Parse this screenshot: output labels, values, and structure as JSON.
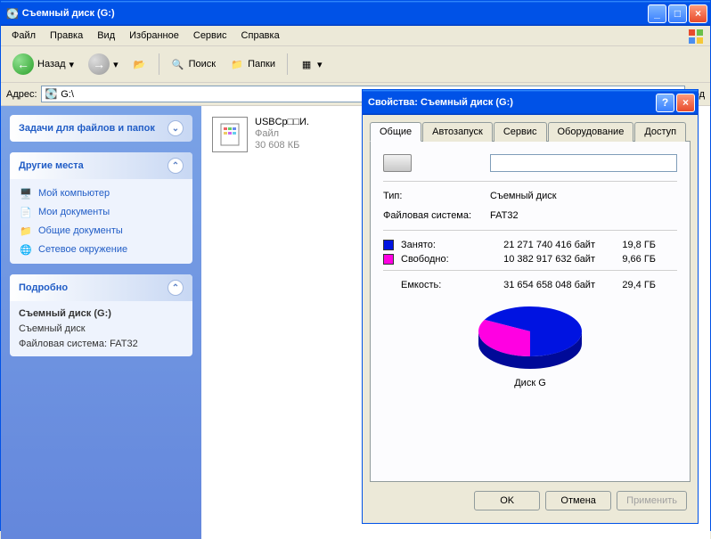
{
  "main": {
    "title": "Съемный диск (G:)",
    "menu": [
      "Файл",
      "Правка",
      "Вид",
      "Избранное",
      "Сервис",
      "Справка"
    ],
    "toolbar": {
      "back": "Назад",
      "search": "Поиск",
      "folders": "Папки"
    },
    "address_label": "Адрес:",
    "address_value": "G:\\",
    "go": "ход",
    "sidebar": {
      "tasks_title": "Задачи для файлов и папок",
      "places_title": "Другие места",
      "places": [
        "Мой компьютер",
        "Мои документы",
        "Общие документы",
        "Сетевое окружение"
      ],
      "details_title": "Подробно",
      "details": {
        "name": "Съемный диск (G:)",
        "type": "Съемный диск",
        "fs": "Файловая система: FAT32"
      }
    },
    "file": {
      "name": "USBCp□□И.",
      "type": "Файл",
      "size": "30 608 КБ"
    }
  },
  "props": {
    "title": "Свойства: Съемный диск (G:)",
    "tabs": [
      "Общие",
      "Автозапуск",
      "Сервис",
      "Оборудование",
      "Доступ"
    ],
    "name_value": "",
    "type_label": "Тип:",
    "type_value": "Съемный диск",
    "fs_label": "Файловая система:",
    "fs_value": "FAT32",
    "used_label": "Занято:",
    "used_bytes": "21 271 740 416 байт",
    "used_gb": "19,8 ГБ",
    "free_label": "Свободно:",
    "free_bytes": "10 382 917 632 байт",
    "free_gb": "9,66 ГБ",
    "cap_label": "Емкость:",
    "cap_bytes": "31 654 658 048 байт",
    "cap_gb": "29,4 ГБ",
    "disk_label": "Диск G",
    "ok": "OK",
    "cancel": "Отмена",
    "apply": "Применить"
  },
  "chart_data": {
    "type": "pie",
    "title": "Диск G",
    "series": [
      {
        "name": "Занято",
        "value": 21271740416,
        "color": "#0013e1"
      },
      {
        "name": "Свободно",
        "value": 10382917632,
        "color": "#ff00e2"
      }
    ]
  }
}
